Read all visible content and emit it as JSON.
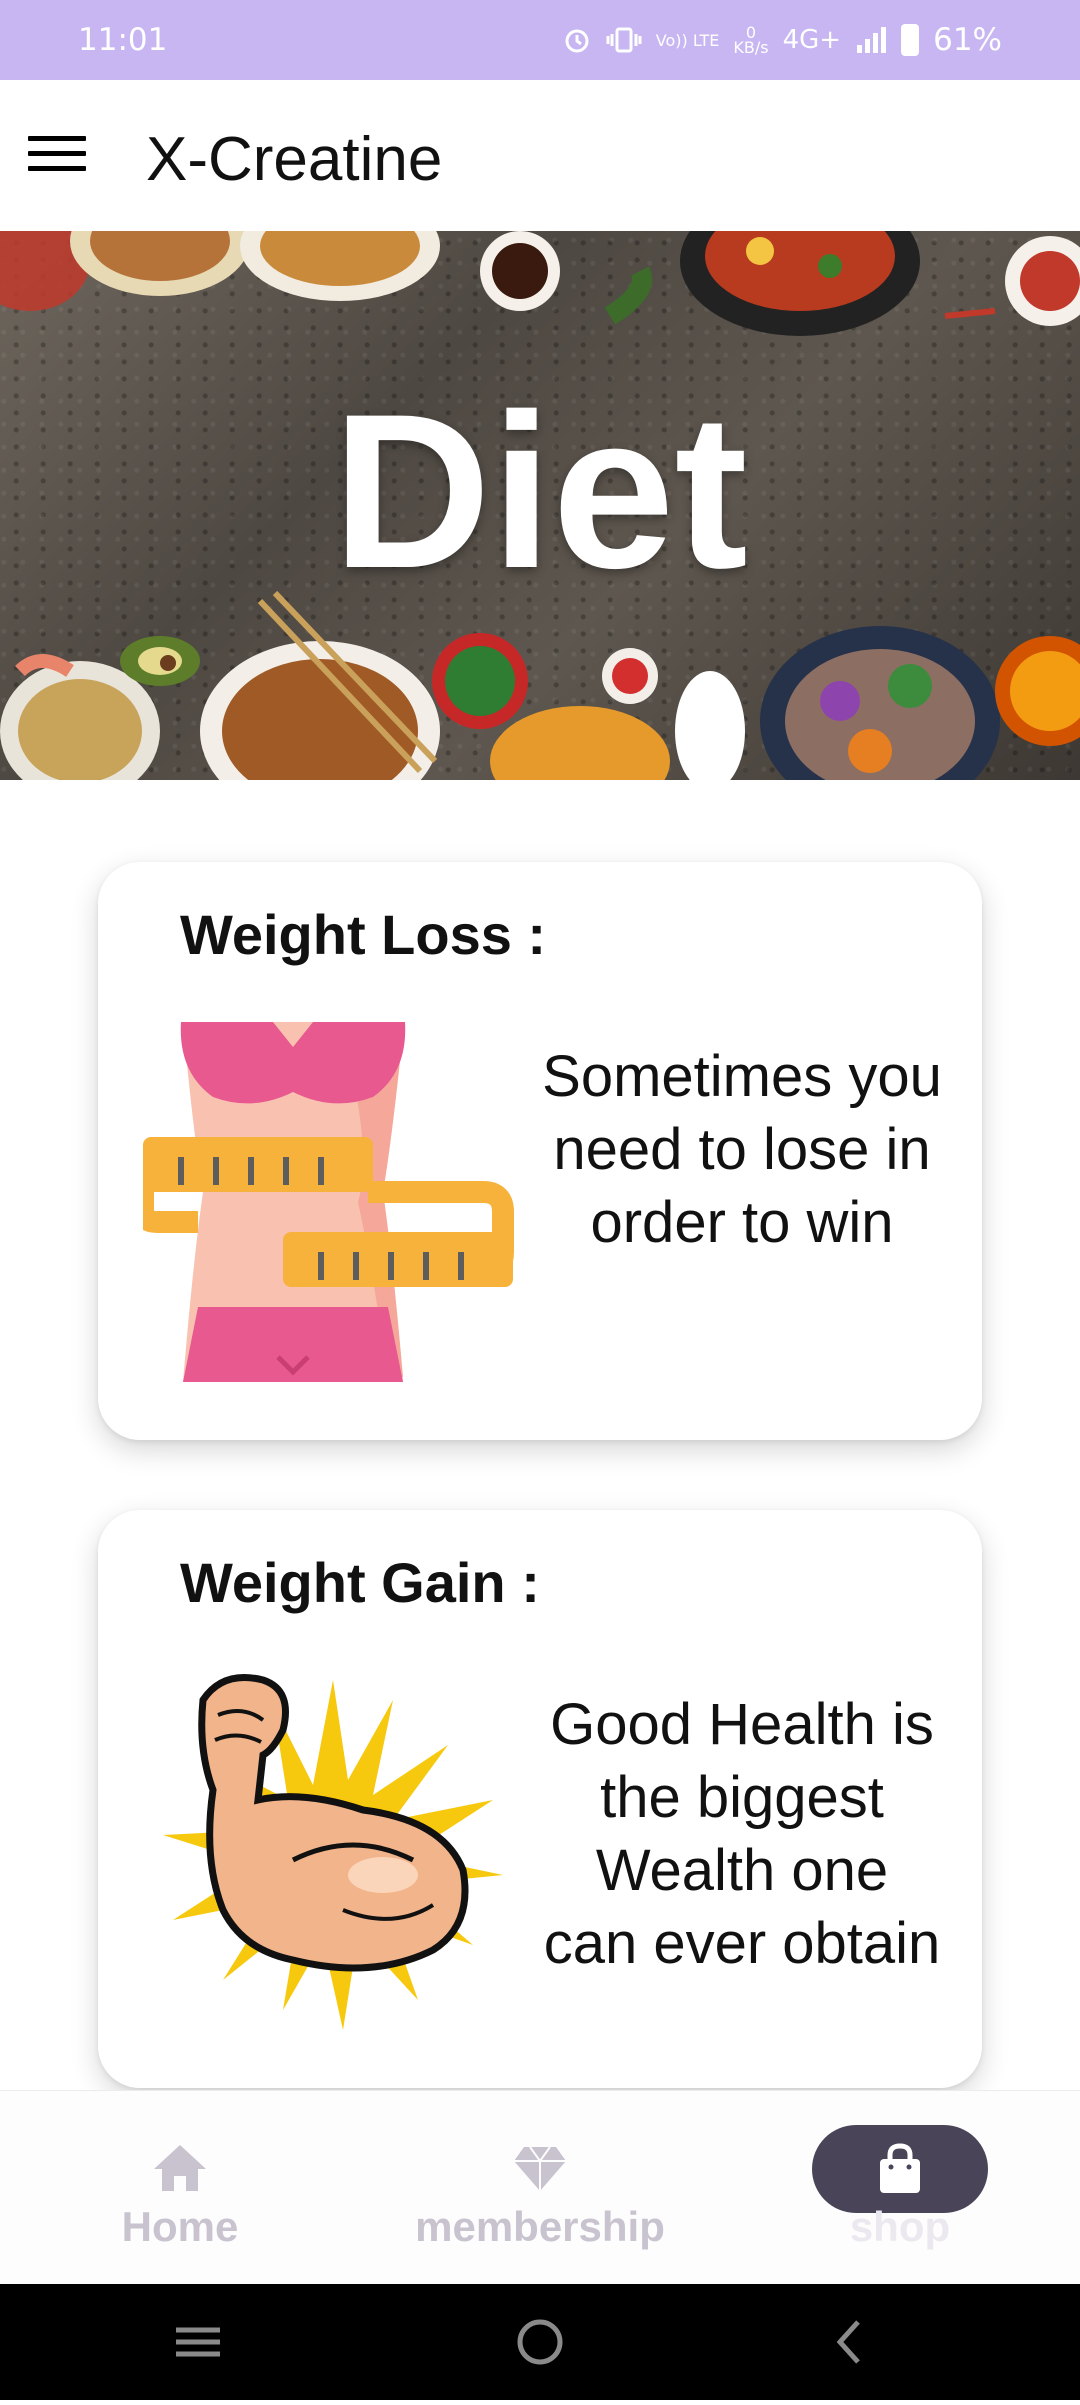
{
  "status_bar": {
    "time": "11:01",
    "volte": "Vo)) LTE",
    "net_speed_value": "0",
    "net_speed_unit": "KB/s",
    "network": "4G+",
    "battery": "61%"
  },
  "app_bar": {
    "title": "X-Creatine"
  },
  "hero": {
    "title": "Diet"
  },
  "cards": [
    {
      "title": "Weight Loss :",
      "quote": "Sometimes you need to lose in order to win"
    },
    {
      "title": "Weight Gain :",
      "quote": "Good Health is the biggest Wealth one can ever obtain"
    }
  ],
  "bottom_nav": {
    "items": [
      {
        "label": "Home",
        "icon": "home-icon"
      },
      {
        "label": "membership",
        "icon": "diamond-icon"
      },
      {
        "label": "shop",
        "icon": "shopping-bag-icon"
      }
    ],
    "selected": "shop"
  },
  "colors": {
    "status_bar": "#c7b6f2",
    "nav_inactive": "#c8c3cf",
    "nav_active_pill": "#4a4458"
  }
}
